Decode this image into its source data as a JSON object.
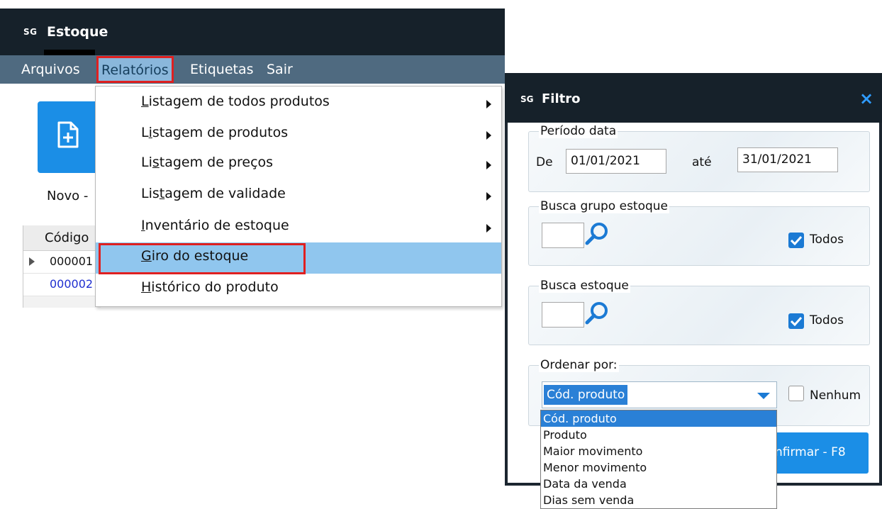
{
  "main_window": {
    "logo": "SG",
    "title": "Estoque",
    "menu": {
      "arquivos": "Arquivos",
      "relatorios": "Relatórios",
      "etiquetas": "Etiquetas",
      "sair": "Sair"
    },
    "novo_label": "Novo -",
    "grid": {
      "header": "Código",
      "rows": [
        "000001",
        "000002"
      ]
    }
  },
  "relatorios_menu": {
    "items": [
      {
        "pre": "",
        "ul": "L",
        "post": "istagem de todos produtos",
        "submenu": true
      },
      {
        "pre": "L",
        "ul": "i",
        "post": "stagem de produtos",
        "submenu": true
      },
      {
        "pre": "Li",
        "ul": "s",
        "post": "tagem de preços",
        "submenu": true
      },
      {
        "pre": "Lis",
        "ul": "t",
        "post": "agem de validade",
        "submenu": true
      },
      {
        "pre": "",
        "ul": "I",
        "post": "nventário de estoque",
        "submenu": true
      },
      {
        "pre": "",
        "ul": "G",
        "post": "iro do estoque",
        "submenu": false
      },
      {
        "pre": "",
        "ul": "H",
        "post": "istórico do produto",
        "submenu": false
      }
    ]
  },
  "filtro": {
    "logo": "SG",
    "title": "Filtro",
    "close": "×",
    "periodo": {
      "legend": "Período data",
      "de_label": "De",
      "de_value": "01/01/2021",
      "ate_label": "até",
      "ate_value": "31/01/2021"
    },
    "grupo": {
      "legend": "Busca grupo estoque",
      "todos": "Todos",
      "checked": true
    },
    "estoque": {
      "legend": "Busca estoque",
      "todos": "Todos",
      "checked": true
    },
    "ordenar": {
      "legend": "Ordenar por:",
      "selected": "Cód. produto",
      "nenhum": "Nenhum",
      "nenhum_checked": false,
      "options": [
        "Cód. produto",
        "Produto",
        "Maior movimento",
        "Menor movimento",
        "Data da venda",
        "Dias sem venda"
      ]
    },
    "confirm": "nfirmar - F8"
  },
  "colors": {
    "title_bar": "#16212a",
    "menu_bar": "#4f6a80",
    "accent_blue": "#1b8ee6",
    "highlight": "#90c6ee",
    "red_box": "#e02020"
  }
}
